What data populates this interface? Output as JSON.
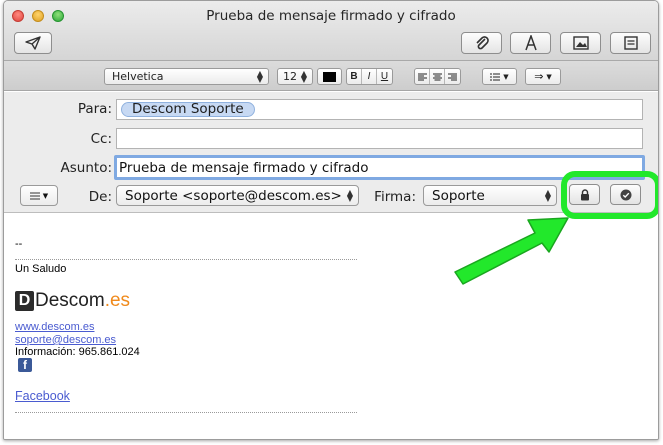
{
  "window": {
    "title": "Prueba de mensaje firmado y cifrado"
  },
  "toolbar": {
    "send_icon": "paper-plane-icon",
    "attach_icon": "paperclip-icon",
    "fonts_icon": "font-icon",
    "photo_icon": "photo-browser-icon",
    "template_icon": "stationery-icon"
  },
  "format": {
    "font": "Helvetica",
    "size": "12",
    "color": "#000000",
    "bold": "B",
    "italic": "I",
    "underline": "U",
    "list_icon": "list-icon",
    "indent_icon": "indent-icon"
  },
  "headers": {
    "to_label": "Para:",
    "to_token": "Descom Soporte",
    "cc_label": "Cc:",
    "cc_value": "",
    "subject_label": "Asunto:",
    "subject_value": "Prueba de mensaje firmado y cifrado",
    "from_label": "De:",
    "from_value": "Soporte <soporte@descom.es>",
    "signature_label": "Firma:",
    "signature_value": "Soporte",
    "encrypt_icon": "lock-icon",
    "sign_icon": "signed-seal-icon"
  },
  "body": {
    "dashes": "--",
    "greeting": "Un Saludo",
    "logo_mark": "D",
    "logo_word": "Descom",
    "logo_tld": ".es",
    "website": "www.descom.es",
    "email": "soporte@descom.es",
    "phone": "Información: 965.861.024",
    "facebook_letter": "f",
    "facebook": "Facebook"
  },
  "colors": {
    "highlight": "#22e82b",
    "link": "#4a5bd0",
    "token_bg": "#c7d9f3",
    "brand_orange": "#f08a1c"
  }
}
